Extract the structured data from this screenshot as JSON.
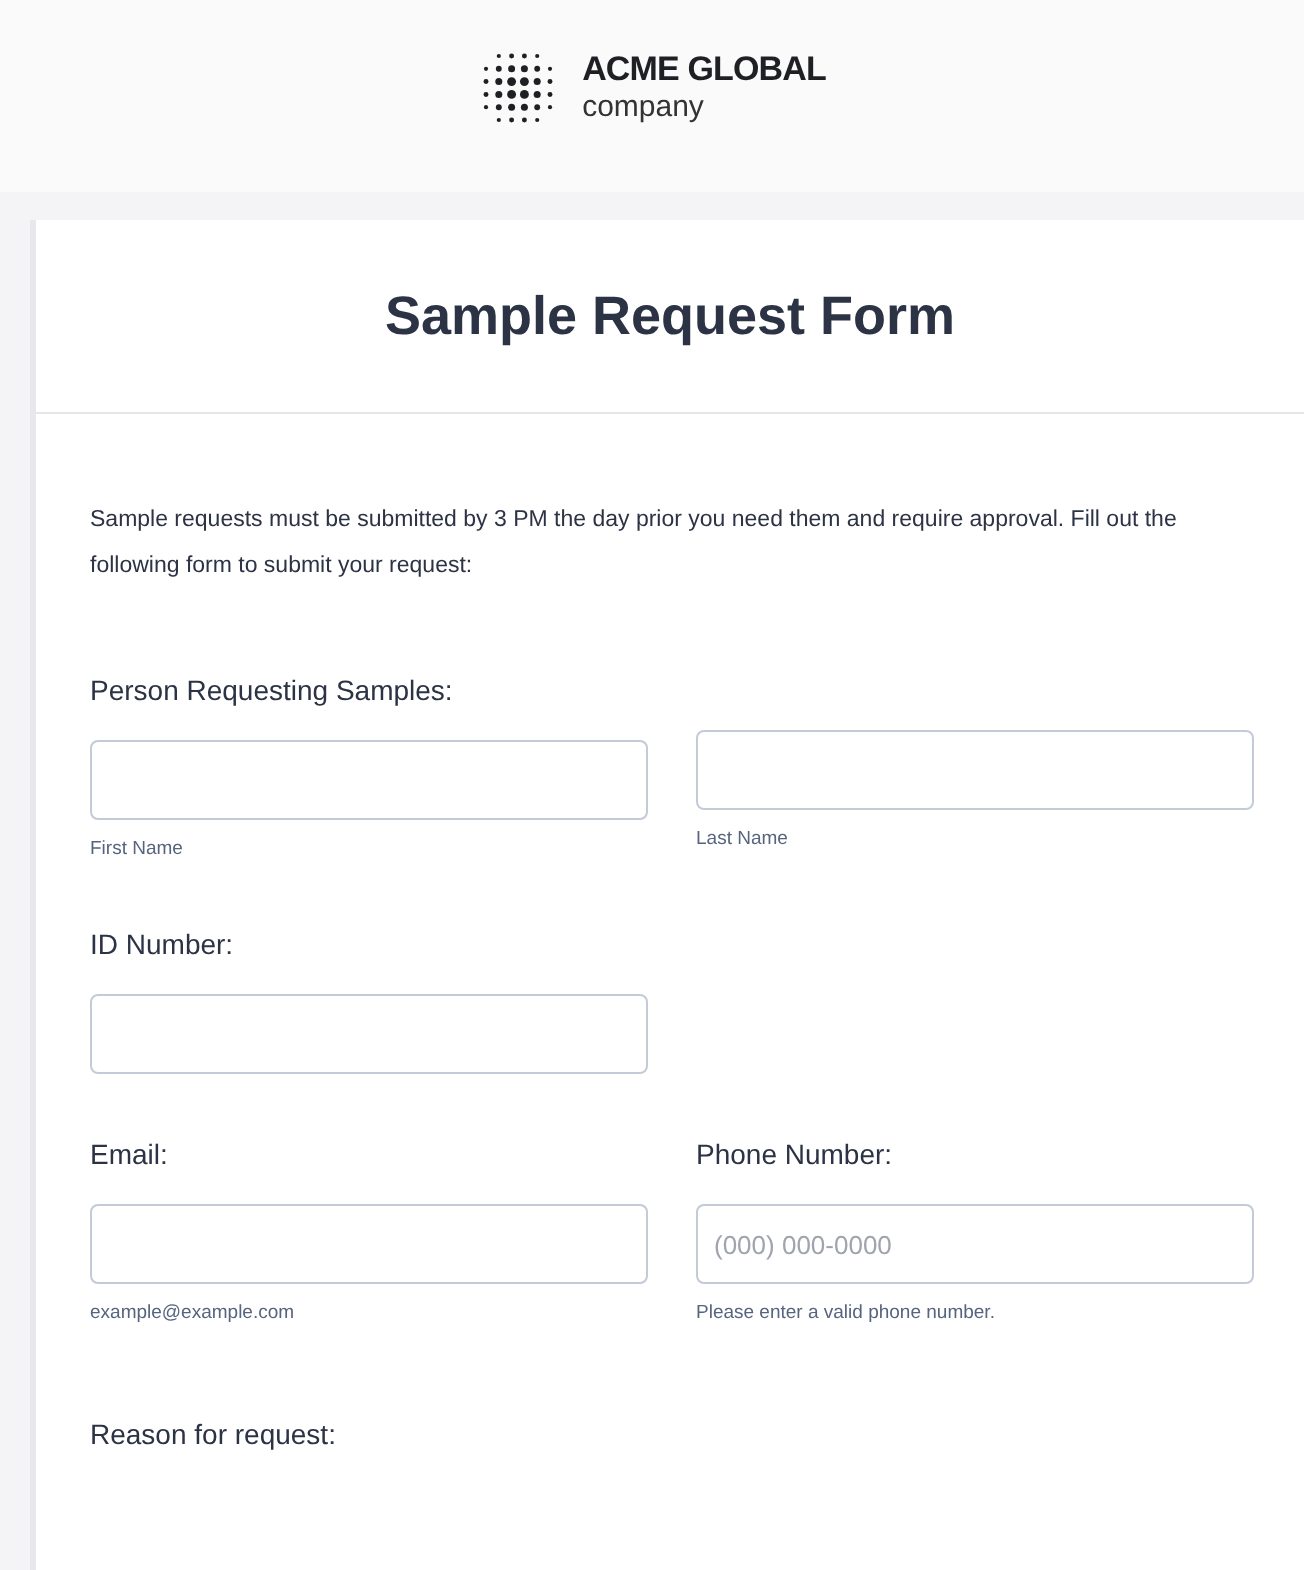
{
  "header": {
    "logo_title": "ACME GLOBAL",
    "logo_subtitle": "company"
  },
  "form": {
    "title": "Sample Request Form",
    "intro": "Sample requests must be submitted by 3 PM the day prior you need them and require approval. Fill out the following form to submit your request:",
    "rows": [
      {
        "fields": [
          {
            "label": "Person Requesting Samples:",
            "sublabel": "First Name"
          },
          {
            "sublabel": "Last Name"
          }
        ]
      },
      {
        "fields": [
          {
            "label": "ID Number:"
          }
        ]
      },
      {
        "fields": [
          {
            "label": "Email:",
            "sublabel": "example@example.com"
          },
          {
            "label": "Phone Number:",
            "placeholder": "(000) 000-0000",
            "sublabel": "Please enter a valid phone number."
          }
        ]
      }
    ],
    "next_label": "Reason for request:"
  }
}
